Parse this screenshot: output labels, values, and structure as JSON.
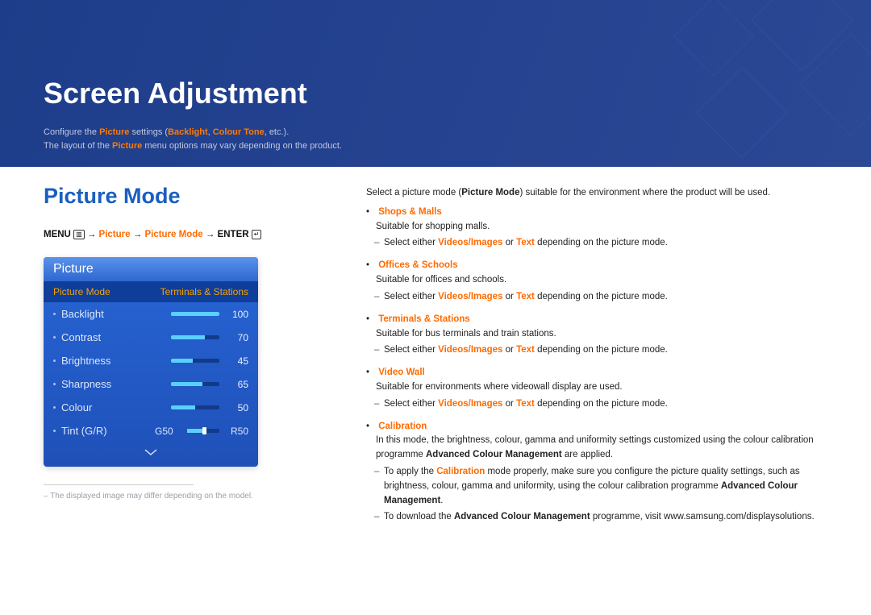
{
  "header": {
    "page_title": "Screen Adjustment",
    "intro_line1_pre": "Configure the ",
    "intro_line1_hl1": "Picture",
    "intro_line1_mid": " settings (",
    "intro_line1_hl2": "Backlight",
    "intro_line1_comma": ", ",
    "intro_line1_hl3": "Colour Tone",
    "intro_line1_end": ", etc.).",
    "intro_line2_pre": "The layout of the ",
    "intro_line2_hl": "Picture",
    "intro_line2_end": " menu options may vary depending on the product."
  },
  "section": {
    "title": "Picture Mode"
  },
  "nav": {
    "menu": "MENU",
    "menu_icon": "▥",
    "arrow": "→",
    "step1": "Picture",
    "step2": "Picture Mode",
    "enter": "ENTER",
    "enter_icon": "↵"
  },
  "osd": {
    "panel_title": "Picture",
    "selected_label": "Picture Mode",
    "selected_value": "Terminals & Stations",
    "rows": [
      {
        "name": "Backlight",
        "value": "100",
        "fill": 100
      },
      {
        "name": "Contrast",
        "value": "70",
        "fill": 70
      },
      {
        "name": "Brightness",
        "value": "45",
        "fill": 45
      },
      {
        "name": "Sharpness",
        "value": "65",
        "fill": 65
      },
      {
        "name": "Colour",
        "value": "50",
        "fill": 50
      }
    ],
    "tint": {
      "name": "Tint (G/R)",
      "g": "G50",
      "r": "R50",
      "pos": 50
    }
  },
  "footnote": "The displayed image may differ depending on the model.",
  "right": {
    "intro_pre": "Select a picture mode (",
    "intro_hl": "Picture Mode",
    "intro_post": ") suitable for the environment where the product will be used.",
    "videos_images": "Videos/Images",
    "text": "Text",
    "modes": {
      "shops": {
        "name": "Shops & Malls",
        "desc": "Suitable for shopping malls.",
        "sub_pre": "Select either ",
        "sub_mid": " or ",
        "sub_post": " depending on the picture mode."
      },
      "offices": {
        "name": "Offices & Schools",
        "desc": "Suitable for offices and schools.",
        "sub_pre": "Select either ",
        "sub_mid": " or ",
        "sub_post": " depending on the picture mode."
      },
      "terminals": {
        "name": "Terminals & Stations",
        "desc": "Suitable for bus terminals and train stations.",
        "sub_pre": "Select either ",
        "sub_mid": " or ",
        "sub_post": " depending on the picture mode."
      },
      "video_wall": {
        "name": "Video Wall",
        "desc": "Suitable for environments where videowall display are used.",
        "sub_pre": "Select either ",
        "sub_mid": " or ",
        "sub_post": " depending on the picture mode."
      },
      "calibration": {
        "name": "Calibration",
        "desc_pre": "In this mode, the brightness, colour, gamma and uniformity settings customized using the colour calibration programme ",
        "desc_b": "Advanced Colour Management",
        "desc_post": " are applied.",
        "sub1_pre": "To apply the ",
        "sub1_hl": "Calibration",
        "sub1_mid": " mode properly, make sure you configure the picture quality settings, such as brightness, colour, gamma and uniformity, using the colour calibration programme ",
        "sub1_b": "Advanced Colour Management",
        "sub1_post": ".",
        "sub2_pre": "To download the ",
        "sub2_b": "Advanced Colour Management",
        "sub2_post": " programme, visit www.samsung.com/displaysolutions."
      }
    }
  }
}
